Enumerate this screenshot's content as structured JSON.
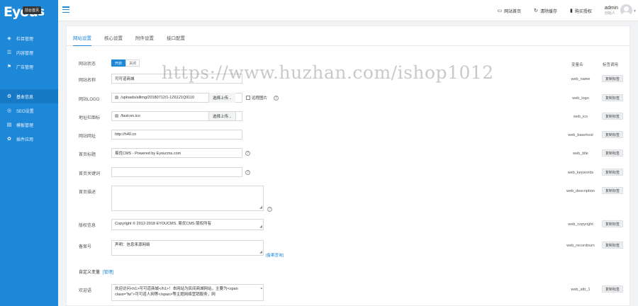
{
  "brand": {
    "logo_text": "Eyou",
    "logo_tail": "s",
    "tooltip": "前台首页"
  },
  "sidebar": {
    "group1": [
      {
        "label": "栏目管理",
        "icon": "layers-icon"
      },
      {
        "label": "内容管理",
        "icon": "list-icon"
      },
      {
        "label": "广告管理",
        "icon": "ad-icon"
      }
    ],
    "group2": [
      {
        "label": "基本信息",
        "icon": "info-icon",
        "active": true
      },
      {
        "label": "SEO设置",
        "icon": "seo-icon"
      },
      {
        "label": "模板管理",
        "icon": "template-icon"
      },
      {
        "label": "插件应用",
        "icon": "plugin-icon"
      }
    ]
  },
  "topbar": {
    "links": [
      {
        "label": "网站首页",
        "icon": "monitor-icon"
      },
      {
        "label": "清除缓存",
        "icon": "refresh-icon"
      },
      {
        "label": "购买授权",
        "icon": "bookmark-icon"
      }
    ],
    "user_name": "admin",
    "user_role": "创始人"
  },
  "tabs": [
    "网站设置",
    "核心设置",
    "附件设置",
    "接口配置"
  ],
  "columns": {
    "var": "变量名",
    "action": "标签调用"
  },
  "copy_label": "复制标签",
  "rows": {
    "status": {
      "label": "网站状态",
      "on": "开启",
      "off": "关闭"
    },
    "name": {
      "label": "网站名称",
      "value": "可可道商城",
      "var": "web_name"
    },
    "logo": {
      "label": "网站LOGO",
      "value": "/uploads/allimg/20180712/1-1Z6121Q9110",
      "upload": "选择上传...",
      "remote": "远程图片",
      "var": "web_logo"
    },
    "ico": {
      "label": "地址栏图标",
      "value": "/favicon.ico",
      "upload": "选择上传...",
      "var": "web_ico"
    },
    "url": {
      "label": "网站网址",
      "value": "http://h40.cn",
      "var": "web_basehost"
    },
    "title": {
      "label": "首页标题",
      "value": "易优CMS - Powered by Eyoucms.com",
      "var": "web_title"
    },
    "keywords": {
      "label": "首页关键词",
      "value": "",
      "var": "web_keywords"
    },
    "description": {
      "label": "首页描述",
      "value": "",
      "var": "web_description"
    },
    "copyright": {
      "label": "版权信息",
      "value": "Copyright © 2012-2018 EYOUCMS. 易优CMS 版权所有",
      "var": "web_copyright"
    },
    "recordnum": {
      "label": "备案号",
      "value": "声明：信息来源网络",
      "link": "[备案查询]",
      "var": "web_recordnum"
    }
  },
  "custom": {
    "title": "自定义变量",
    "manage": "[管理]"
  },
  "attr": {
    "label": "欢迎语",
    "value": "欢迎访问<h1>可可道商城</h1>！本网站为民间商城网站，主要为<span class=\"fw\">可可道人网等</span>等主题网络营销服务，网",
    "var": "web_attr_1"
  },
  "watermark": "https://www.huzhan.com/ishop1012"
}
